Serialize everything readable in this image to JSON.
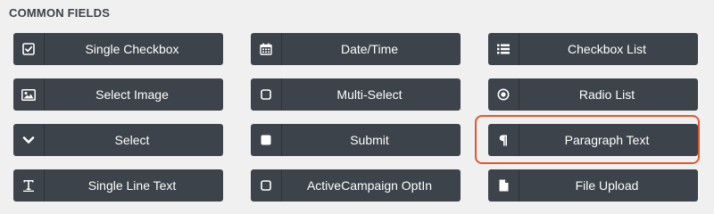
{
  "section": {
    "title": "COMMON FIELDS"
  },
  "fields": [
    {
      "label": "Single Checkbox",
      "icon": "checkbox-icon"
    },
    {
      "label": "Date/Time",
      "icon": "calendar-icon"
    },
    {
      "label": "Checkbox List",
      "icon": "list-icon"
    },
    {
      "label": "Select Image",
      "icon": "image-icon"
    },
    {
      "label": "Multi-Select",
      "icon": "square-outline-icon"
    },
    {
      "label": "Radio List",
      "icon": "radio-icon"
    },
    {
      "label": "Select",
      "icon": "chevron-down-icon"
    },
    {
      "label": "Submit",
      "icon": "square-filled-icon"
    },
    {
      "label": "Paragraph Text",
      "icon": "pilcrow-icon"
    },
    {
      "label": "Single Line Text",
      "icon": "text-icon"
    },
    {
      "label": "ActiveCampaign OptIn",
      "icon": "square-outline-icon"
    },
    {
      "label": "File Upload",
      "icon": "file-icon"
    }
  ],
  "highlighted_field": "Paragraph Text",
  "colors": {
    "background": "#f0f0f1",
    "button_bg": "#3c434a",
    "button_text": "#ffffff",
    "title_text": "#3c434a",
    "highlight": "#e0582f"
  }
}
